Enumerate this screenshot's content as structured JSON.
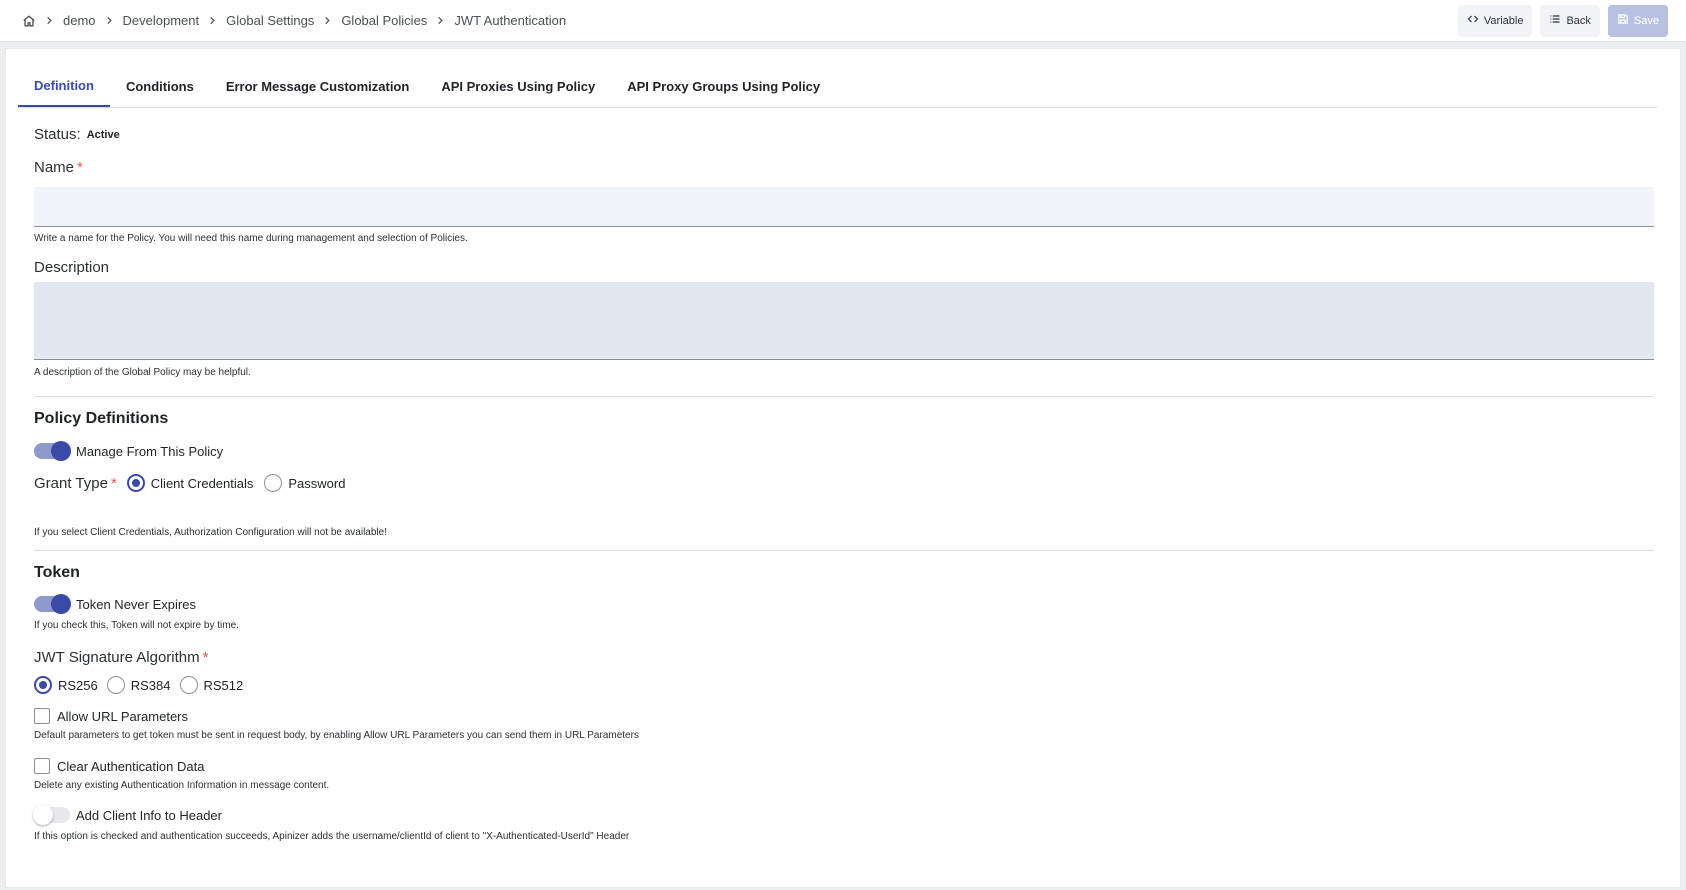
{
  "breadcrumb": {
    "home_icon": "home-icon",
    "items": [
      "demo",
      "Development",
      "Global Settings",
      "Global Policies",
      "JWT Authentication"
    ]
  },
  "actions": {
    "variable_label": "Variable",
    "back_label": "Back",
    "save_label": "Save"
  },
  "tabs": [
    {
      "label": "Definition",
      "active": true
    },
    {
      "label": "Conditions"
    },
    {
      "label": "Error Message Customization"
    },
    {
      "label": "API Proxies Using Policy"
    },
    {
      "label": "API Proxy Groups Using Policy"
    }
  ],
  "status": {
    "label": "Status:",
    "value": "Active"
  },
  "name": {
    "label": "Name",
    "required": "*",
    "value": "",
    "help": "Write a name for the Policy. You will need this name during management and selection of Policies."
  },
  "description": {
    "label": "Description",
    "value": "",
    "help": "A description of the Global Policy may be helpful."
  },
  "policy_definitions": {
    "title": "Policy Definitions",
    "manage_label": "Manage From This Policy",
    "manage_on": true,
    "grant_type": {
      "label": "Grant Type",
      "required": "*",
      "options": [
        "Client Credentials",
        "Password"
      ],
      "selected": "Client Credentials",
      "help": "If you select Client Credentials, Authorization Configuration will not be available!"
    }
  },
  "token": {
    "title": "Token",
    "never_expires_label": "Token Never Expires",
    "never_expires_on": true,
    "never_expires_help": "If you check this, Token will not expire by time.",
    "algorithm": {
      "label": "JWT Signature Algorithm",
      "required": "*",
      "options": [
        "RS256",
        "RS384",
        "RS512"
      ],
      "selected": "RS256"
    },
    "allow_url": {
      "label": "Allow URL Parameters",
      "checked": false,
      "help": "Default parameters to get token must be sent in request body, by enabling Allow URL Parameters you can send them in URL Parameters"
    },
    "clear_auth": {
      "label": "Clear Authentication Data",
      "checked": false,
      "help": "Delete any existing Authentication Information in message content."
    },
    "client_info": {
      "label": "Add Client Info to Header",
      "on": false,
      "help": "If this option is checked and authentication succeeds, Apinizer adds the username/clientId of client to \"X-Authenticated-UserId\" Header"
    }
  },
  "colors": {
    "accent": "#3b4aa8",
    "required": "#e05a5a",
    "save_disabled": "#b9c1e0"
  }
}
